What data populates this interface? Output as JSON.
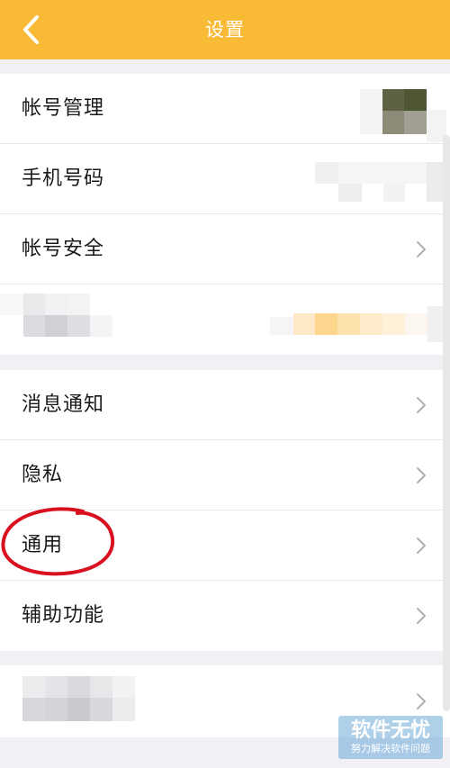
{
  "header": {
    "title": "设置",
    "back_icon": "chevron-left-icon",
    "bg_color": "#f9ba36"
  },
  "groups": [
    {
      "items": [
        {
          "label": "帐号管理",
          "chevron": false
        },
        {
          "label": "手机号码",
          "chevron": false
        },
        {
          "label": "帐号安全",
          "chevron": true
        },
        {
          "label": "",
          "chevron": false
        }
      ]
    },
    {
      "items": [
        {
          "label": "消息通知",
          "chevron": true
        },
        {
          "label": "隐私",
          "chevron": true
        },
        {
          "label": "通用",
          "chevron": true,
          "highlighted": true
        },
        {
          "label": "辅助功能",
          "chevron": true
        }
      ]
    },
    {
      "items": [
        {
          "label": "",
          "chevron": true
        }
      ]
    }
  ],
  "watermark": {
    "title": "软件无忧",
    "subtitle": "努力解决软件问题"
  },
  "annotation_color": "#d9101e"
}
